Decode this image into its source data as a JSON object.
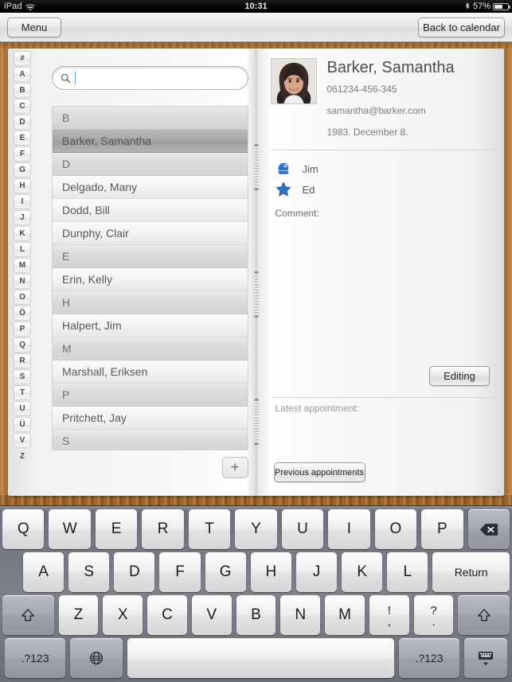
{
  "status_bar": {
    "device": "iPad",
    "wifi_icon": "wifi-icon",
    "time": "10:31",
    "bluetooth_icon": "bluetooth-icon",
    "battery_percent": "57%",
    "battery_level": 57
  },
  "navbar": {
    "menu_label": "Menu",
    "back_label": "Back to calendar"
  },
  "search": {
    "icon": "search-icon",
    "value": "",
    "placeholder": ""
  },
  "alphabet_index": [
    "#",
    "A",
    "B",
    "C",
    "D",
    "E",
    "F",
    "G",
    "H",
    "I",
    "J",
    "K",
    "L",
    "M",
    "N",
    "O",
    "Ö",
    "P",
    "Q",
    "R",
    "S",
    "T",
    "U",
    "Ü",
    "V",
    "Z"
  ],
  "contact_list": {
    "rows": [
      {
        "type": "section",
        "label": "B"
      },
      {
        "type": "contact",
        "label": "Barker, Samantha",
        "selected": true
      },
      {
        "type": "section",
        "label": "D"
      },
      {
        "type": "contact",
        "label": "Delgado, Many",
        "selected": false
      },
      {
        "type": "contact",
        "label": "Dodd, Bill",
        "selected": false
      },
      {
        "type": "contact",
        "label": "Dunphy, Clair",
        "selected": false
      },
      {
        "type": "section",
        "label": "E"
      },
      {
        "type": "contact",
        "label": "Erin, Kelly",
        "selected": false
      },
      {
        "type": "section",
        "label": "H"
      },
      {
        "type": "contact",
        "label": "Halpert, Jim",
        "selected": false
      },
      {
        "type": "section",
        "label": "M"
      },
      {
        "type": "contact",
        "label": "Marshall, Eriksen",
        "selected": false
      },
      {
        "type": "section",
        "label": "P"
      },
      {
        "type": "contact",
        "label": "Pritchett, Jay",
        "selected": false
      },
      {
        "type": "section",
        "label": "S"
      }
    ],
    "add_label": "+"
  },
  "detail": {
    "avatar_icon": "contact-photo",
    "name": "Barker, Samantha",
    "phone": "061234-456-345",
    "email": "samantha@barker.com",
    "birthday": "1983. December 8.",
    "relations": [
      {
        "icon": "baby-icon",
        "name": "Jim",
        "color": "#2f72c9"
      },
      {
        "icon": "star-icon",
        "name": "Ed",
        "color": "#2f72c9"
      }
    ],
    "comment_label": "Comment:",
    "comment_value": "",
    "editing_label": "Editing",
    "latest_appointment_label": "Latest appointment:",
    "previous_appointments_label": "Previous appointments"
  },
  "keyboard": {
    "row1": [
      "Q",
      "W",
      "E",
      "R",
      "T",
      "Y",
      "U",
      "I",
      "O",
      "P"
    ],
    "backspace_icon": "backspace-icon",
    "row2": [
      "A",
      "S",
      "D",
      "F",
      "G",
      "H",
      "J",
      "K",
      "L"
    ],
    "return_label": "Return",
    "shift_icon": "shift-icon",
    "row3": [
      "Z",
      "X",
      "C",
      "V",
      "B",
      "N",
      "M"
    ],
    "punct1_top": "!",
    "punct1_bottom": ",",
    "punct2_top": "?",
    "punct2_bottom": ".",
    "numbers_label": ".?123",
    "globe_icon": "globe-icon",
    "space_label": "",
    "hide_keyboard_icon": "hide-keyboard-icon"
  }
}
